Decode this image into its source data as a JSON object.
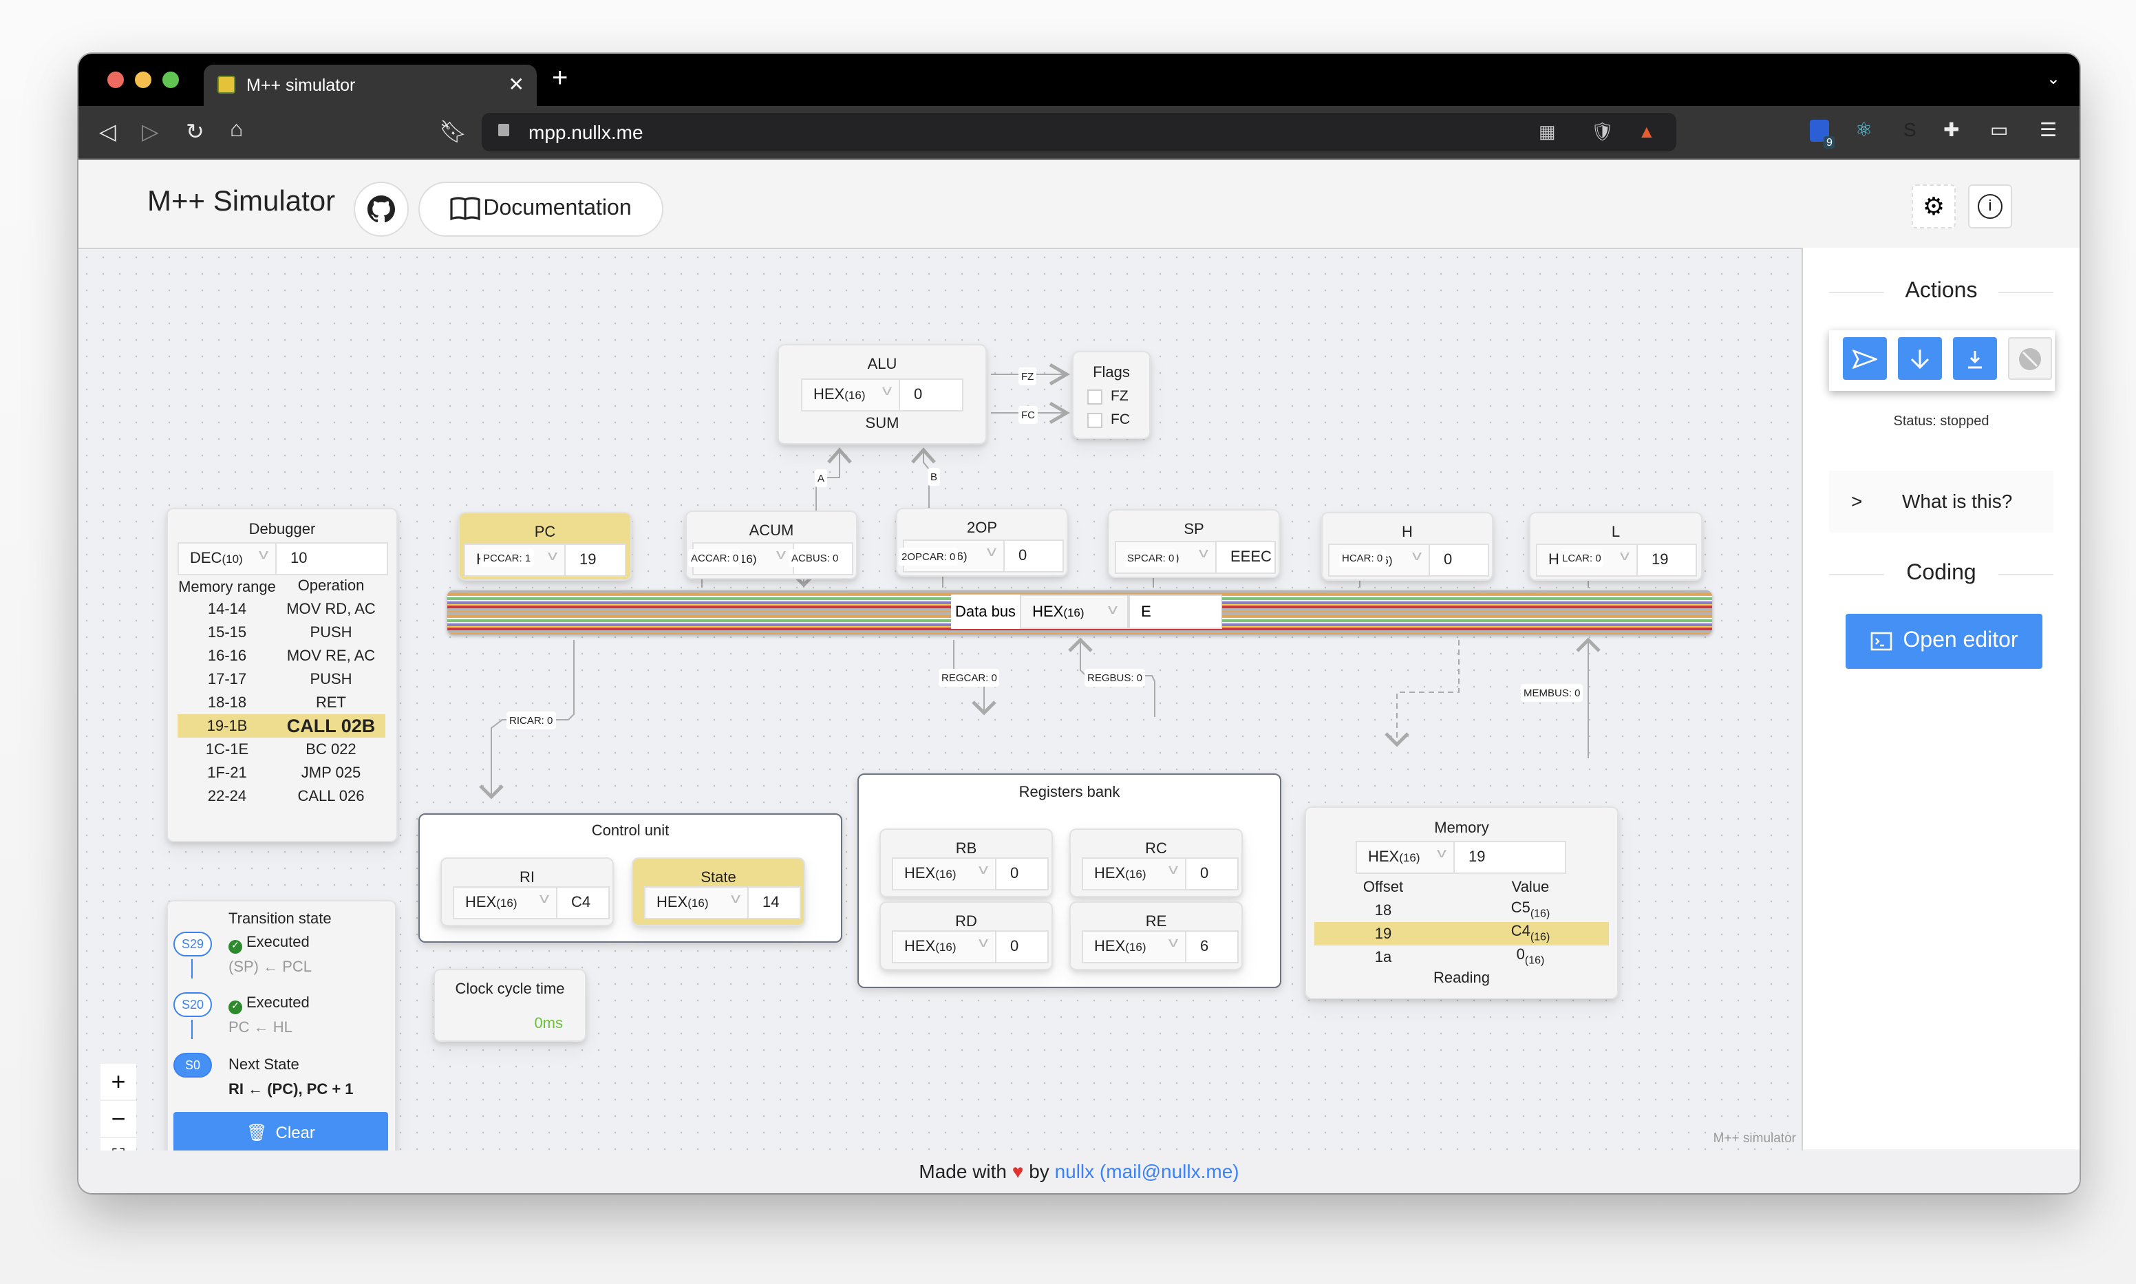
{
  "browser": {
    "tab_title": "M++ simulator",
    "url": "mpp.nullx.me",
    "extension_badge": "9"
  },
  "header": {
    "title": "M++ Simulator",
    "docs_label": "Documentation"
  },
  "alu": {
    "title": "ALU",
    "base": "HEX",
    "base_sub": "(16)",
    "value": "0",
    "operation": "SUM"
  },
  "flags": {
    "title": "Flags",
    "items": [
      {
        "label": "FZ",
        "checked": false
      },
      {
        "label": "FC",
        "checked": false
      }
    ]
  },
  "wires": {
    "alu_fz": "FZ",
    "alu_fc": "FC",
    "alu_a": "A",
    "alu_b": "B",
    "pccar": "PCCAR: 1",
    "accar": "ACCAR: 0",
    "acbus": "ACBUS: 0",
    "opcar": "2OPCAR: 0",
    "spcar": "SPCAR: 0",
    "hcar": "HCAR: 0",
    "lcar": "LCAR: 0",
    "ricar": "RICAR: 0",
    "regcar": "REGCAR: 0",
    "regbus": "REGBUS: 0",
    "membus": "MEMBUS: 0"
  },
  "registers": {
    "pc": {
      "title": "PC",
      "base": "HEX",
      "base_sub": "(16)",
      "value": "19",
      "active": true
    },
    "acum": {
      "title": "ACUM",
      "base": "HEX",
      "base_sub": "(16)",
      "value": "0"
    },
    "op2": {
      "title": "2OP",
      "base": "HEX",
      "base_sub": "(16)",
      "value": "0"
    },
    "sp": {
      "title": "SP",
      "base": "HEX",
      "base_sub": "(16)",
      "value": "EEEC"
    },
    "h": {
      "title": "H",
      "base": "HEX",
      "base_sub": "(16)",
      "value": "0"
    },
    "l": {
      "title": "L",
      "base": "HEX",
      "base_sub": "(16)",
      "value": "19"
    }
  },
  "data_bus": {
    "label": "Data bus",
    "base": "HEX",
    "base_sub": "(16)",
    "value": "E"
  },
  "debugger": {
    "title": "Debugger",
    "base": "DEC",
    "base_sub": "(10)",
    "value": "10",
    "col_memory": "Memory range",
    "col_operation": "Operation",
    "rows": [
      {
        "range": "14-14",
        "op": "MOV RD, AC"
      },
      {
        "range": "15-15",
        "op": "PUSH"
      },
      {
        "range": "16-16",
        "op": "MOV RE, AC"
      },
      {
        "range": "17-17",
        "op": "PUSH"
      },
      {
        "range": "18-18",
        "op": "RET"
      },
      {
        "range": "19-1B",
        "op": "CALL 02B",
        "current": true
      },
      {
        "range": "1C-1E",
        "op": "BC 022"
      },
      {
        "range": "1F-21",
        "op": "JMP 025"
      },
      {
        "range": "22-24",
        "op": "CALL 026"
      }
    ]
  },
  "control_unit": {
    "title": "Control unit",
    "ri": {
      "title": "RI",
      "base": "HEX",
      "base_sub": "(16)",
      "value": "C4"
    },
    "state": {
      "title": "State",
      "base": "HEX",
      "base_sub": "(16)",
      "value": "14",
      "active": true
    }
  },
  "clock": {
    "title": "Clock cycle time",
    "value": "0ms"
  },
  "registers_bank": {
    "title": "Registers bank",
    "rb": {
      "title": "RB",
      "base": "HEX",
      "base_sub": "(16)",
      "value": "0"
    },
    "rc": {
      "title": "RC",
      "base": "HEX",
      "base_sub": "(16)",
      "value": "0"
    },
    "rd": {
      "title": "RD",
      "base": "HEX",
      "base_sub": "(16)",
      "value": "0"
    },
    "re": {
      "title": "RE",
      "base": "HEX",
      "base_sub": "(16)",
      "value": "6"
    }
  },
  "memory": {
    "title": "Memory",
    "base": "HEX",
    "base_sub": "(16)",
    "value": "19",
    "col_offset": "Offset",
    "col_value": "Value",
    "rows": [
      {
        "offset": "18",
        "value": "C5",
        "sub": "(16)"
      },
      {
        "offset": "19",
        "value": "C4",
        "sub": "(16)",
        "current": true
      },
      {
        "offset": "1a",
        "value": "0",
        "sub": "(16)"
      }
    ],
    "status": "Reading"
  },
  "transition": {
    "title": "Transition state",
    "steps": [
      {
        "state": "S29",
        "status": "Executed",
        "op": "(SP) ← PCL"
      },
      {
        "state": "S20",
        "status": "Executed",
        "op": "PC ← HL"
      },
      {
        "state": "S0",
        "status": "Next State",
        "op": "RI ← (PC), PC + 1"
      }
    ],
    "clear_label": "Clear"
  },
  "canvas": {
    "watermark": "M++ simulator"
  },
  "sidebar": {
    "actions_title": "Actions",
    "status": "Status: stopped",
    "what_is_this": "What is this?",
    "coding_title": "Coding",
    "open_editor": "Open editor"
  },
  "footer": {
    "made_with": "Made with",
    "by": "by",
    "author": "nullx (mail@nullx.me)"
  },
  "colors": {
    "accent": "#4490f4",
    "highlight": "#eedc8f",
    "success": "#2d8a2d",
    "clock": "#6abf3b"
  }
}
